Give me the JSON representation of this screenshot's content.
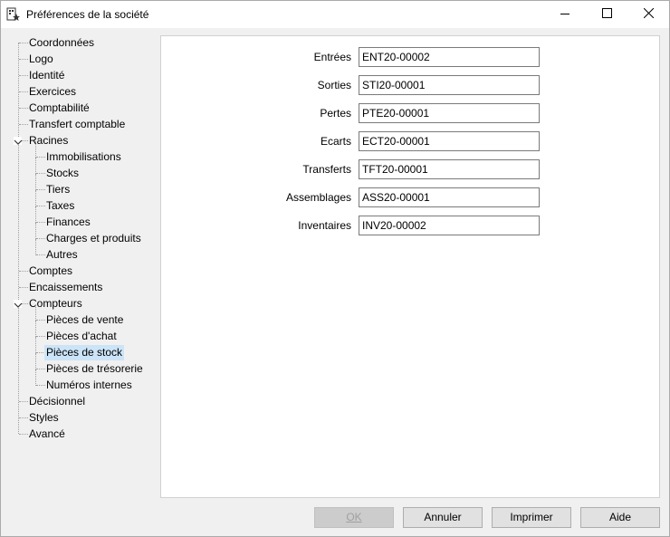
{
  "window": {
    "title": "Préférences de la société",
    "app_icon": "company-settings-icon",
    "controls": [
      "minimize-icon",
      "maximize-icon",
      "close-icon"
    ]
  },
  "tree": {
    "items": [
      {
        "label": "Coordonnées",
        "level": 0
      },
      {
        "label": "Logo",
        "level": 0
      },
      {
        "label": "Identité",
        "level": 0
      },
      {
        "label": "Exercices",
        "level": 0
      },
      {
        "label": "Comptabilité",
        "level": 0
      },
      {
        "label": "Transfert comptable",
        "level": 0
      },
      {
        "label": "Racines",
        "level": 0,
        "expanded": true
      },
      {
        "label": "Immobilisations",
        "level": 1
      },
      {
        "label": "Stocks",
        "level": 1
      },
      {
        "label": "Tiers",
        "level": 1
      },
      {
        "label": "Taxes",
        "level": 1
      },
      {
        "label": "Finances",
        "level": 1
      },
      {
        "label": "Charges et produits",
        "level": 1
      },
      {
        "label": "Autres",
        "level": 1
      },
      {
        "label": "Comptes",
        "level": 0
      },
      {
        "label": "Encaissements",
        "level": 0
      },
      {
        "label": "Compteurs",
        "level": 0,
        "expanded": true
      },
      {
        "label": "Pièces de vente",
        "level": 1
      },
      {
        "label": "Pièces d'achat",
        "level": 1
      },
      {
        "label": "Pièces de stock",
        "level": 1,
        "selected": true
      },
      {
        "label": "Pièces de trésorerie",
        "level": 1
      },
      {
        "label": "Numéros internes",
        "level": 1
      },
      {
        "label": "Décisionnel",
        "level": 0
      },
      {
        "label": "Styles",
        "level": 0
      },
      {
        "label": "Avancé",
        "level": 0
      }
    ]
  },
  "form": {
    "fields": [
      {
        "label": "Entrées",
        "value": "ENT20-00002"
      },
      {
        "label": "Sorties",
        "value": "STI20-00001"
      },
      {
        "label": "Pertes",
        "value": "PTE20-00001"
      },
      {
        "label": "Ecarts",
        "value": "ECT20-00001"
      },
      {
        "label": "Transferts",
        "value": "TFT20-00001"
      },
      {
        "label": "Assemblages",
        "value": "ASS20-00001"
      },
      {
        "label": "Inventaires",
        "value": "INV20-00002"
      }
    ]
  },
  "buttons": {
    "ok": {
      "label": "OK",
      "disabled": true
    },
    "cancel": {
      "label": "Annuler"
    },
    "print": {
      "label": "Imprimer"
    },
    "help": {
      "label": "Aide"
    }
  },
  "colors": {
    "selection": "#cce4f7",
    "window_bg": "#f0f0f0",
    "panel_bg": "#ffffff"
  }
}
